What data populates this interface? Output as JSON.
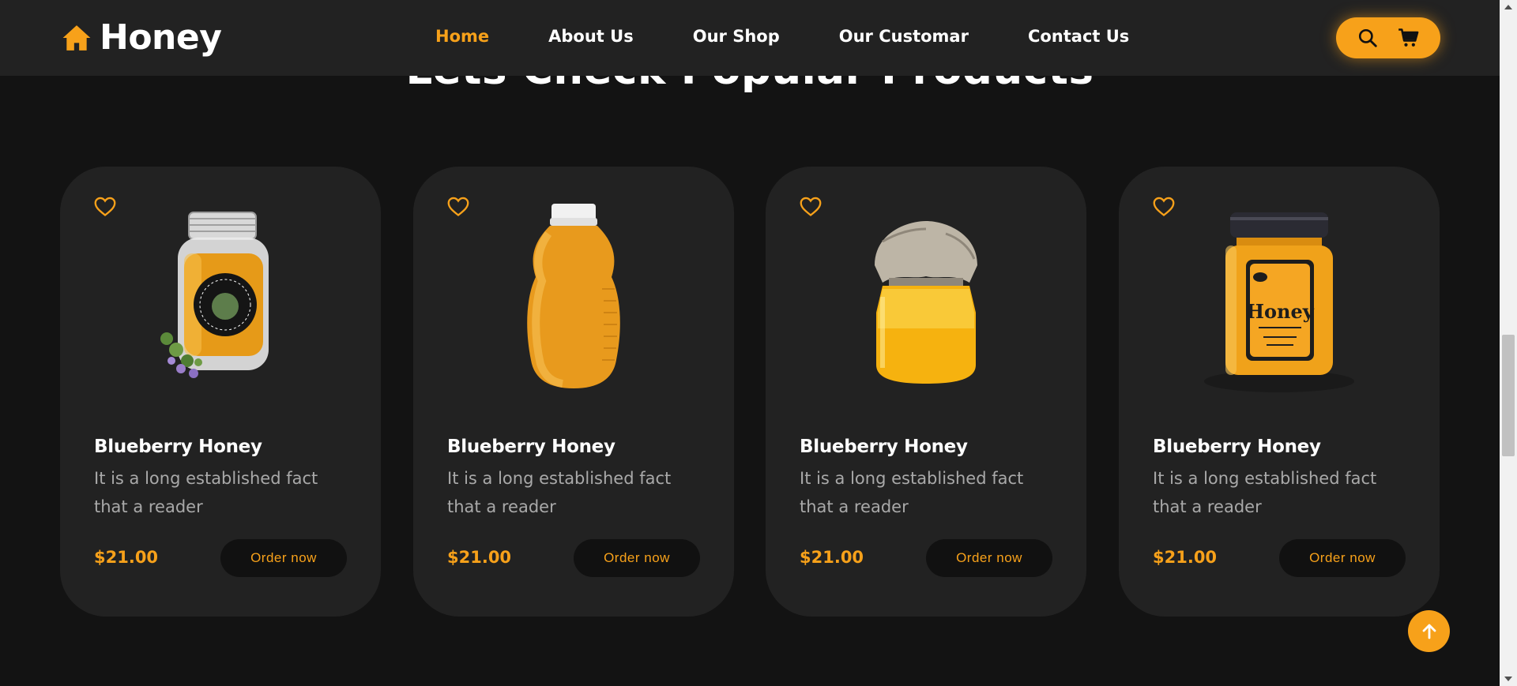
{
  "brand": {
    "name": "Honey",
    "logo_icon": "home-icon",
    "accent_color": "#f7a11a"
  },
  "nav": {
    "items": [
      {
        "label": "Home",
        "active": true
      },
      {
        "label": "About Us",
        "active": false
      },
      {
        "label": "Our Shop",
        "active": false
      },
      {
        "label": "Our Customar",
        "active": false
      },
      {
        "label": "Contact Us",
        "active": false
      }
    ]
  },
  "header_actions": {
    "search_icon": "search-icon",
    "cart_icon": "cart-icon"
  },
  "section": {
    "title": "Lets Check Popular Products"
  },
  "products": [
    {
      "title": "Blueberry Honey",
      "description": "It is a long established fact that a reader",
      "price": "$21.00",
      "button": "Order now",
      "image": "jar-with-herbs"
    },
    {
      "title": "Blueberry Honey",
      "description": "It is a long established fact that a reader",
      "price": "$21.00",
      "button": "Order now",
      "image": "squeeze-bottle"
    },
    {
      "title": "Blueberry Honey",
      "description": "It is a long established fact that a reader",
      "price": "$21.00",
      "button": "Order now",
      "image": "cloth-covered-jar"
    },
    {
      "title": "Blueberry Honey",
      "description": "It is a long established fact that a reader",
      "price": "$21.00",
      "button": "Order now",
      "image": "labeled-jar",
      "label_text": "Honey"
    }
  ],
  "scroll_top_icon": "arrow-up-icon"
}
